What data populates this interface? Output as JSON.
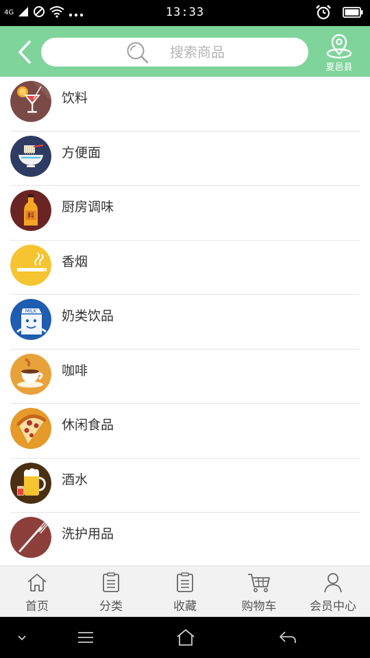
{
  "status_bar": {
    "network": "4G",
    "time": "13:33"
  },
  "header": {
    "search_placeholder": "搜索商品",
    "location_label": "夏邑县"
  },
  "categories": [
    {
      "label": "饮料",
      "icon": "cocktail-icon",
      "bg": "#7a4a46"
    },
    {
      "label": "方便面",
      "icon": "noodle-bowl-icon",
      "bg": "#2e3b63"
    },
    {
      "label": "厨房调味",
      "icon": "seasoning-bottle-icon",
      "bg": "#6b2424"
    },
    {
      "label": "香烟",
      "icon": "cigarette-icon",
      "bg": "#f5c430"
    },
    {
      "label": "奶类饮品",
      "icon": "milk-carton-icon",
      "bg": "#1f5db0"
    },
    {
      "label": "咖啡",
      "icon": "coffee-cup-icon",
      "bg": "#e8a23a"
    },
    {
      "label": "休闲食品",
      "icon": "pizza-slice-icon",
      "bg": "#e59a2a"
    },
    {
      "label": "酒水",
      "icon": "beer-mug-icon",
      "bg": "#4a2f12"
    },
    {
      "label": "洗护用品",
      "icon": "toothbrush-icon",
      "bg": "#8c3f3b"
    }
  ],
  "tabbar": [
    {
      "label": "首页",
      "icon": "home-icon"
    },
    {
      "label": "分类",
      "icon": "category-list-icon"
    },
    {
      "label": "收藏",
      "icon": "favorites-clipboard-icon"
    },
    {
      "label": "购物车",
      "icon": "shopping-cart-icon"
    },
    {
      "label": "会员中心",
      "icon": "user-profile-icon"
    }
  ],
  "colors": {
    "header_bg": "#7fd49b",
    "tabbar_bg": "#f2f2f2",
    "divider": "#e4e4e4"
  }
}
